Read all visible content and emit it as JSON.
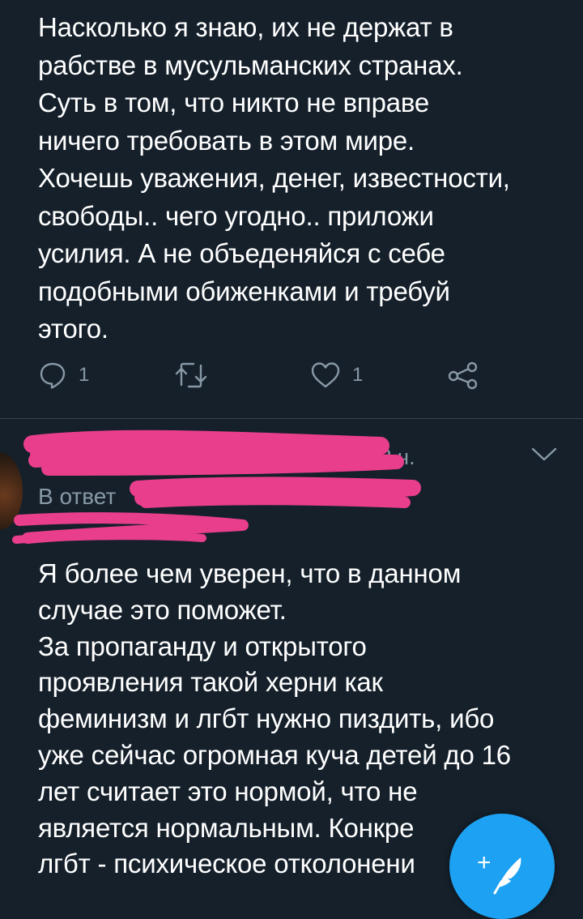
{
  "tweet1": {
    "text_lines": [
      "Насколько я знаю, их не держат в",
      "рабстве в мусульманских странах.",
      "Суть в том, что никто не вправе",
      "ничего требовать в этом мире.",
      "Хочешь уважения, денег, известности,",
      "свободы.. чего угодно.. приложи",
      "усилия. А не объеденяйся с себе",
      "подобными обиженками и требуй",
      "этого."
    ],
    "actions": {
      "reply_icon": "reply-icon",
      "reply_count": "1",
      "retweet_icon": "retweet-icon",
      "like_icon": "heart-icon",
      "like_count": "1",
      "share_icon": "share-icon"
    }
  },
  "tweet2": {
    "timestamp": "· 2 ч.",
    "reply_prefix": "В ответ",
    "text_lines": [
      "Я более чем уверен, что в данном",
      "случае это поможет.",
      "За пропаганду и открытого",
      "проявления такой херни как",
      "феминизм и лгбт нужно пиздить, ибо",
      "уже сейчас огромная куча детей до 16",
      "лет считает это нормой, что не",
      "является нормальным. Конкре",
      "лгбт - психическое отколонени"
    ]
  },
  "compose_button": {
    "icon": "compose-feather-icon",
    "plus": "+"
  },
  "colors": {
    "background": "#15202b",
    "secondary_text": "#8899a6",
    "accent": "#1da1f2",
    "redaction": "#e83e8c"
  }
}
